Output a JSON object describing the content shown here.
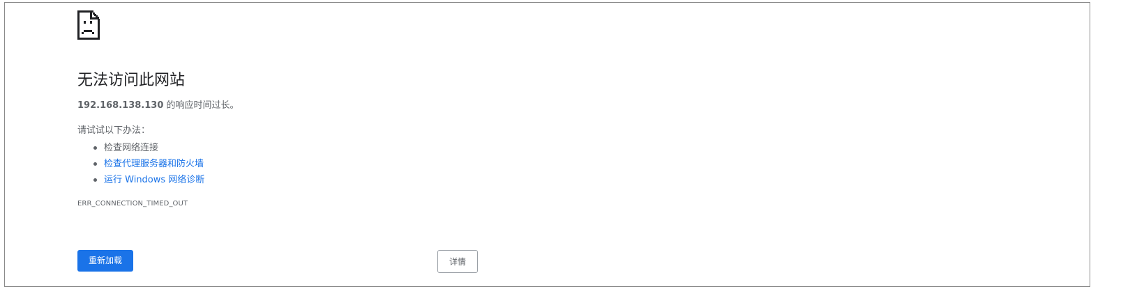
{
  "error_page": {
    "icon": "sad-page-icon",
    "title": "无法访问此网站",
    "host": "192.168.138.130",
    "summary_suffix": " 的响应时间过长。",
    "suggestions_heading": "请试试以下办法：",
    "suggestions": [
      {
        "label": "检查网络连接",
        "link": false
      },
      {
        "label": "检查代理服务器和防火墙",
        "link": true
      },
      {
        "label": "运行 Windows 网络诊断",
        "link": true
      }
    ],
    "error_code": "ERR_CONNECTION_TIMED_OUT",
    "reload_label": "重新加载",
    "details_label": "详情"
  },
  "colors": {
    "primary_button": "#1a73e8",
    "link": "#1a73e8",
    "text": "#5f6368",
    "title": "#202124"
  }
}
